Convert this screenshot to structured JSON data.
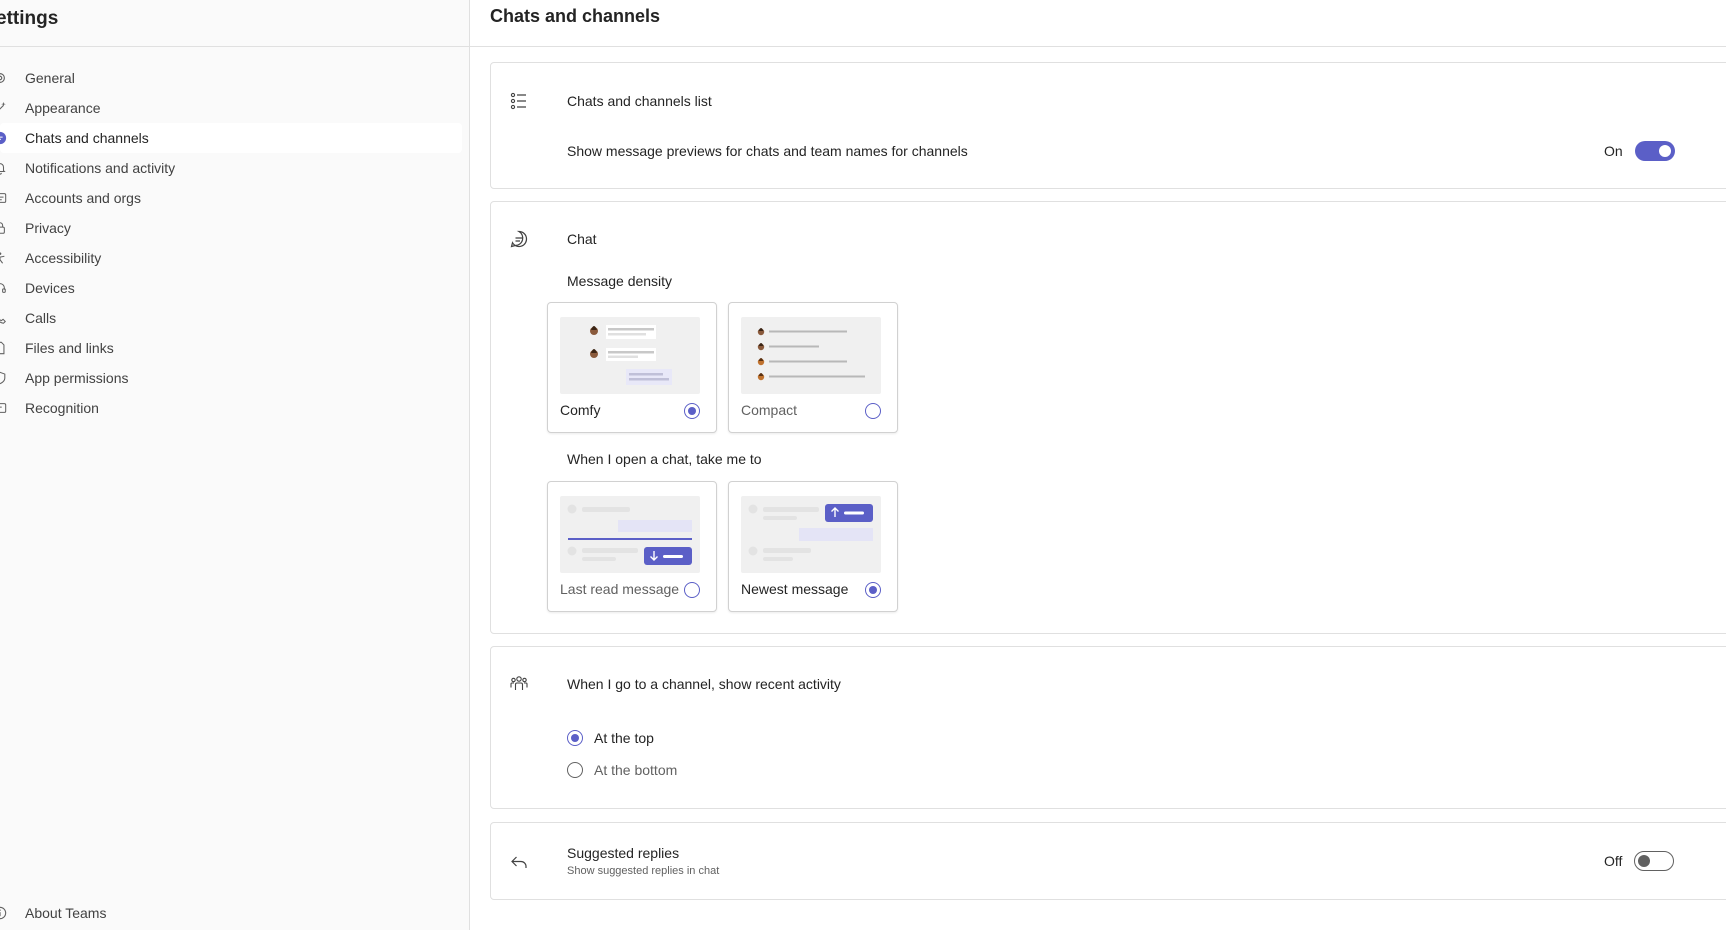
{
  "sidebar": {
    "title": "ettings",
    "items": [
      {
        "label": "General",
        "icon": "gear-icon"
      },
      {
        "label": "Appearance",
        "icon": "magic-wand-icon"
      },
      {
        "label": "Chats and channels",
        "icon": "chat-icon",
        "active": true
      },
      {
        "label": "Notifications and activity",
        "icon": "bell-icon"
      },
      {
        "label": "Accounts and orgs",
        "icon": "contact-card-icon"
      },
      {
        "label": "Privacy",
        "icon": "lock-icon"
      },
      {
        "label": "Accessibility",
        "icon": "accessibility-icon"
      },
      {
        "label": "Devices",
        "icon": "headset-icon"
      },
      {
        "label": "Calls",
        "icon": "phone-icon"
      },
      {
        "label": "Files and links",
        "icon": "document-icon"
      },
      {
        "label": "App permissions",
        "icon": "shield-icon"
      },
      {
        "label": "Recognition",
        "icon": "ribbon-icon"
      }
    ],
    "about": {
      "label": "About Teams",
      "icon": "info-icon"
    }
  },
  "main": {
    "title": "Chats and channels",
    "list_section": {
      "heading": "Chats and channels list",
      "setting": "Show message previews for chats and team names for channels",
      "toggle_label": "On",
      "toggle_state": "on"
    },
    "chat_section": {
      "heading": "Chat",
      "density_label": "Message density",
      "density_options": [
        {
          "label": "Comfy",
          "selected": true
        },
        {
          "label": "Compact",
          "selected": false
        }
      ],
      "open_label": "When I open a chat, take me to",
      "open_options": [
        {
          "label": "Last read message",
          "selected": false
        },
        {
          "label": "Newest message",
          "selected": true
        }
      ]
    },
    "channel_section": {
      "heading": "When I go to a channel, show recent activity",
      "options": [
        {
          "label": "At the top",
          "selected": true
        },
        {
          "label": "At the bottom",
          "selected": false
        }
      ]
    },
    "suggested_section": {
      "heading": "Suggested replies",
      "subtext": "Show suggested replies in chat",
      "toggle_label": "Off",
      "toggle_state": "off"
    }
  },
  "colors": {
    "accent": "#5b5fc7",
    "sidebar_bg": "#fafafa",
    "border": "#e0e0e0"
  }
}
